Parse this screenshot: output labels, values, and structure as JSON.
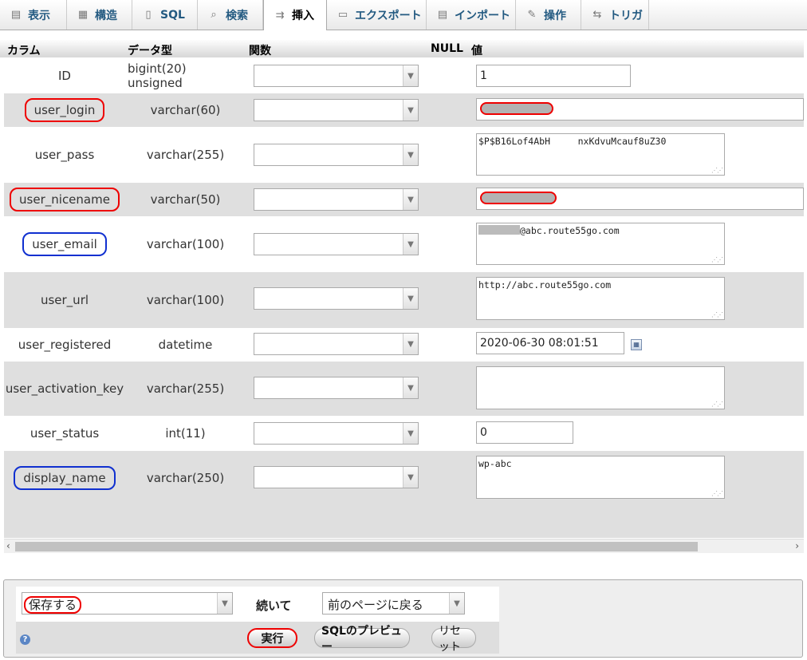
{
  "tabs": [
    {
      "label": "表示",
      "icon": "browse-icon"
    },
    {
      "label": "構造",
      "icon": "structure-icon"
    },
    {
      "label": "SQL",
      "icon": "sql-icon"
    },
    {
      "label": "検索",
      "icon": "search-icon"
    },
    {
      "label": "挿入",
      "icon": "insert-icon",
      "active": true
    },
    {
      "label": "エクスポート",
      "icon": "export-icon"
    },
    {
      "label": "インポート",
      "icon": "import-icon"
    },
    {
      "label": "操作",
      "icon": "operations-icon"
    },
    {
      "label": "トリガ",
      "icon": "triggers-icon"
    }
  ],
  "grid": {
    "headers": {
      "column": "カラム",
      "type": "データ型",
      "function": "関数",
      "null": "NULL",
      "value": "値"
    },
    "rows": [
      {
        "column": "ID",
        "type": "bigint(20) unsigned",
        "value": "1"
      },
      {
        "column": "user_login",
        "type": "varchar(60)",
        "value": ""
      },
      {
        "column": "user_pass",
        "type": "varchar(255)",
        "value": "$P$B16Lof4AbH     nxKdvuMcauf8uZ30"
      },
      {
        "column": "user_nicename",
        "type": "varchar(50)",
        "value": ""
      },
      {
        "column": "user_email",
        "type": "varchar(100)",
        "value": "@abc.route55go.com"
      },
      {
        "column": "user_url",
        "type": "varchar(100)",
        "value": "http://abc.route55go.com"
      },
      {
        "column": "user_registered",
        "type": "datetime",
        "value": "2020-06-30 08:01:51"
      },
      {
        "column": "user_activation_key",
        "type": "varchar(255)",
        "value": ""
      },
      {
        "column": "user_status",
        "type": "int(11)",
        "value": "0"
      },
      {
        "column": "display_name",
        "type": "varchar(250)",
        "value": "wp-abc"
      }
    ]
  },
  "actions": {
    "save_option": "保存する",
    "then_label": "続いて",
    "after_option": "前のページに戻る",
    "go_button": "実行",
    "preview_button": "SQLのプレビュー",
    "reset_button": "リセット"
  },
  "colors": {
    "accent_red": "#ee0000",
    "accent_blue": "#1030d0",
    "row_even": "#dfdfdf"
  }
}
